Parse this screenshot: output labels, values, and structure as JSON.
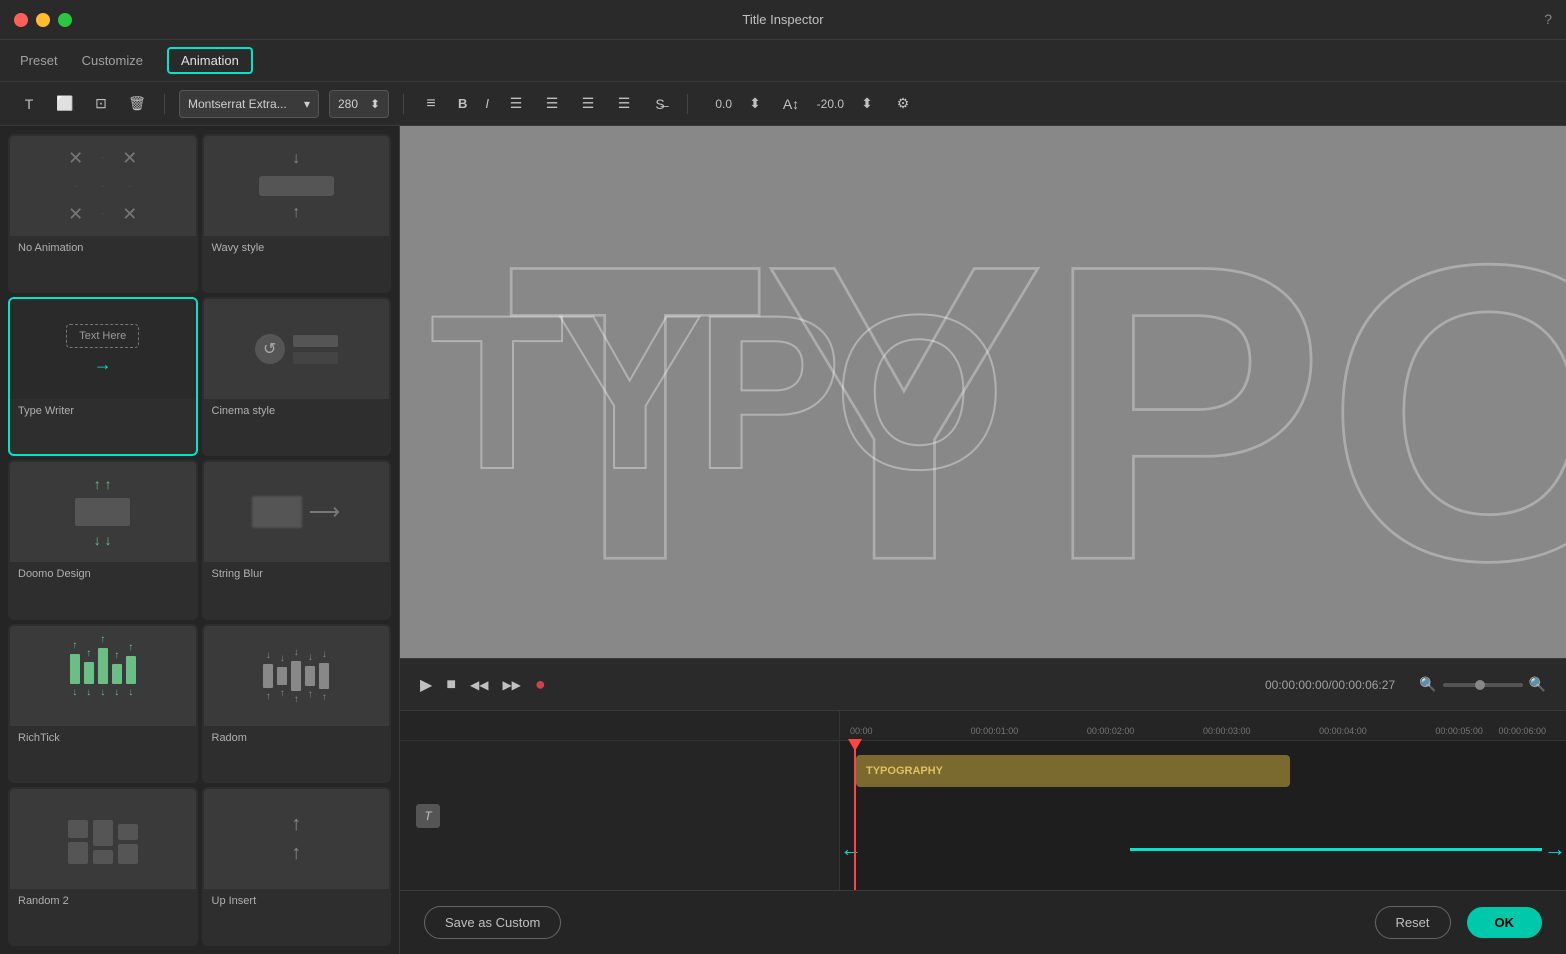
{
  "window": {
    "title": "Title Inspector",
    "close_btn": "●",
    "min_btn": "●",
    "max_btn": "●"
  },
  "tabs": {
    "items": [
      {
        "label": "Preset",
        "active": false
      },
      {
        "label": "Customize",
        "active": false
      },
      {
        "label": "Animation",
        "active": true
      }
    ]
  },
  "toolbar": {
    "font_name": "Montserrat Extra...",
    "font_size": "280",
    "bold_label": "B",
    "italic_label": "I",
    "num1": "0.0",
    "num2": "-20.0"
  },
  "animation_items": [
    {
      "id": "no-animation",
      "label": "No Animation",
      "selected": false
    },
    {
      "id": "wavy-style",
      "label": "Wavy style",
      "selected": false
    },
    {
      "id": "type-writer",
      "label": "Type Writer",
      "selected": true
    },
    {
      "id": "cinema-style",
      "label": "Cinema style",
      "selected": false
    },
    {
      "id": "doomo-design",
      "label": "Doomo Design",
      "selected": false
    },
    {
      "id": "string-blur",
      "label": "String Blur",
      "selected": false
    },
    {
      "id": "richtick",
      "label": "RichTick",
      "selected": false
    },
    {
      "id": "radom",
      "label": "Radom",
      "selected": false
    },
    {
      "id": "random-2",
      "label": "Random 2",
      "selected": false
    },
    {
      "id": "up-insert",
      "label": "Up Insert",
      "selected": false
    }
  ],
  "preview": {
    "text": "TYPO"
  },
  "player": {
    "time_current": "00:00:00:00",
    "time_total": "00:00:06:27",
    "play_icon": "▶",
    "stop_icon": "■",
    "prev_icon": "◀◀",
    "next_icon": "▶▶",
    "record_icon": "●"
  },
  "timeline": {
    "track_label": "TYPOGRAPHY",
    "ruler_marks": [
      "00:00",
      "00:00:01:00",
      "00:00:02:00",
      "00:00:03:00",
      "00:00:04:00",
      "00:00:05:00",
      "00:00:06:00"
    ]
  },
  "bottom_bar": {
    "save_custom_label": "Save as Custom",
    "reset_label": "Reset",
    "ok_label": "OK"
  }
}
